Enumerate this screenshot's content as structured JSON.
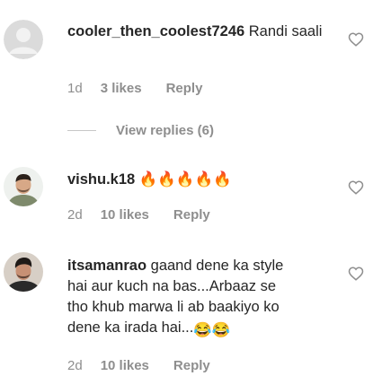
{
  "comments": [
    {
      "username": "cooler_then_coolest7246",
      "text": "Randi saali",
      "time": "1d",
      "likes": "3 likes",
      "reply": "Reply",
      "avatar": "default-avatar-icon"
    },
    {
      "username": "vishu.k18",
      "text": "🔥🔥🔥🔥🔥",
      "time": "2d",
      "likes": "10 likes",
      "reply": "Reply",
      "avatar": "user-photo"
    },
    {
      "username": "itsamanrao",
      "text_lines": [
        "gaand dene ka style",
        "hai aur kuch na bas...Arbaaz se",
        "tho khub marwa li ab baakiyo ko",
        "dene ka irada hai..."
      ],
      "emojis": "😂😂",
      "time": "2d",
      "likes": "10 likes",
      "reply": "Reply",
      "avatar": "user-photo"
    }
  ],
  "view_replies": "View replies (6)",
  "icons": {
    "like": "heart-outline-icon"
  },
  "colors": {
    "text": "#262626",
    "meta": "#8e8e8e",
    "icon": "#8e8e8e"
  }
}
